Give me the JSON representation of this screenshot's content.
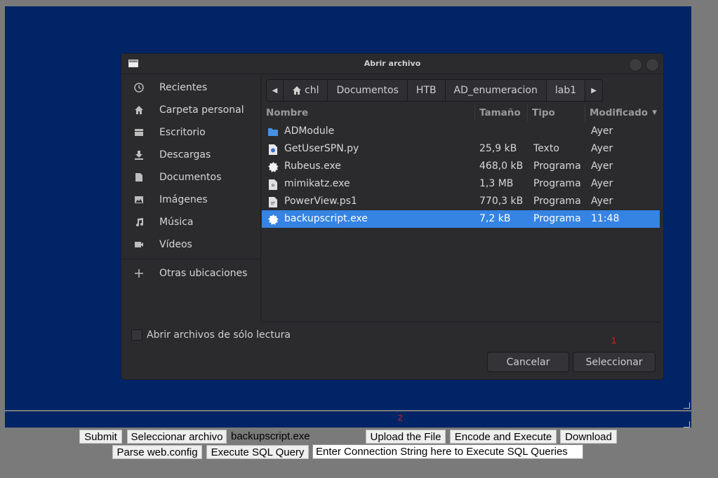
{
  "dialog": {
    "title": "Abrir archivo",
    "sidebar": [
      {
        "label": "Recientes",
        "icon": "clock-icon"
      },
      {
        "label": "Carpeta personal",
        "icon": "home-icon"
      },
      {
        "label": "Escritorio",
        "icon": "desktop-icon"
      },
      {
        "label": "Descargas",
        "icon": "download-icon"
      },
      {
        "label": "Documentos",
        "icon": "document-icon"
      },
      {
        "label": "Imágenes",
        "icon": "image-icon"
      },
      {
        "label": "Música",
        "icon": "music-icon"
      },
      {
        "label": "Vídeos",
        "icon": "video-icon"
      },
      {
        "label": "Otras ubicaciones",
        "icon": "plus-icon"
      }
    ],
    "path": [
      "chl",
      "Documentos",
      "HTB",
      "AD_enumeracion",
      "lab1"
    ],
    "columns": {
      "name": "Nombre",
      "size": "Tamaño",
      "type": "Tipo",
      "modified": "Modificado"
    },
    "files": [
      {
        "name": "ADModule",
        "size": "",
        "type": "",
        "modified": "Ayer",
        "icon": "folder-icon"
      },
      {
        "name": "GetUserSPN.py",
        "size": "25,9 kB",
        "type": "Texto",
        "modified": "Ayer",
        "icon": "python-file-icon"
      },
      {
        "name": "Rubeus.exe",
        "size": "468,0 kB",
        "type": "Programa",
        "modified": "Ayer",
        "icon": "executable-icon"
      },
      {
        "name": "mimikatz.exe",
        "size": "1,3 MB",
        "type": "Programa",
        "modified": "Ayer",
        "icon": "executable-file-icon"
      },
      {
        "name": "PowerView.ps1",
        "size": "770,3 kB",
        "type": "Programa",
        "modified": "Ayer",
        "icon": "script-file-icon"
      },
      {
        "name": "backupscript.exe",
        "size": "7,2 kB",
        "type": "Programa",
        "modified": "11:48",
        "icon": "executable-icon",
        "selected": true
      }
    ],
    "readonly_label": "Abrir archivos de sólo lectura",
    "cancel_label": "Cancelar",
    "select_label": "Seleccionar",
    "marker": "1"
  },
  "strip_marker": "2",
  "form": {
    "submit": "Submit",
    "choose_file": "Seleccionar archivo",
    "chosen_file": "backupscript.exe",
    "upload": "Upload the File",
    "encode": "Encode and Execute",
    "download": "Download",
    "parse": "Parse web.config",
    "sql": "Execute SQL Query",
    "connection_value": "Enter Connection String here to Execute SQL Queries"
  },
  "colors": {
    "desktop_bg": "#002466",
    "selection": "#3583e3",
    "marker": "#e0211a"
  }
}
